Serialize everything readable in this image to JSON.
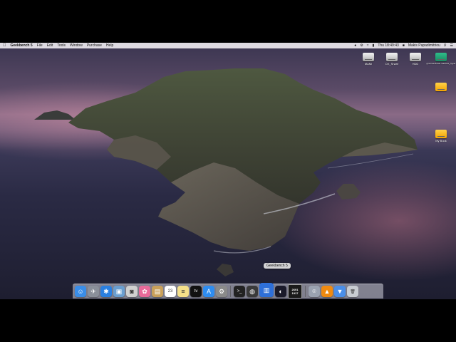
{
  "menubar": {
    "apple": "",
    "app_name": "Geekbench 5",
    "items": [
      "File",
      "Edit",
      "Tools",
      "Window",
      "Purchase",
      "Help"
    ],
    "clock": "Thu 18:49:43",
    "user": "Makis Papadimitriou"
  },
  "desktop_icons": [
    {
      "label": "MAMI",
      "type": "drive"
    },
    {
      "label": "OX_Share",
      "type": "drive"
    },
    {
      "label": "HDD",
      "type": "drive"
    },
    {
      "label": "gnomes18 fast machine_hyper",
      "type": "green"
    },
    {
      "label": "",
      "type": "yellow"
    },
    {
      "label": "My Book",
      "type": "yellow"
    }
  ],
  "dock": {
    "tooltip": "Geekbench 5",
    "badge_top": "2691",
    "badge_bottom": "1917",
    "items": [
      {
        "name": "finder-icon",
        "color": "#3a8de8"
      },
      {
        "name": "launchpad-icon",
        "color": "#8a8f9a"
      },
      {
        "name": "safari-icon",
        "color": "#2a7fe0"
      },
      {
        "name": "preview-icon",
        "color": "#6a9ed0"
      },
      {
        "name": "photos-preview-icon",
        "color": "#d0d0d0"
      },
      {
        "name": "photos-icon",
        "color": "#e86a9a"
      },
      {
        "name": "notes-folder-icon",
        "color": "#c9a05a"
      },
      {
        "name": "calendar-icon",
        "color": "#ffffff"
      },
      {
        "name": "notes-icon",
        "color": "#f5e08a"
      },
      {
        "name": "apple-tv-icon",
        "color": "#111111"
      },
      {
        "name": "app-store-icon",
        "color": "#2e8cf0"
      },
      {
        "name": "system-preferences-icon",
        "color": "#8a8a8a"
      },
      {
        "name": "terminal-icon",
        "color": "#222222"
      },
      {
        "name": "disk-utility-icon",
        "color": "#3a3a3a"
      },
      {
        "name": "geekbench-icon",
        "color": "#2e6fd8"
      },
      {
        "name": "cinebench-icon",
        "color": "#1a1a2a"
      },
      {
        "name": "geekbench-results-icon",
        "color": "#1a1a1a"
      },
      {
        "name": "image-capture-icon",
        "color": "#9aa2b0"
      },
      {
        "name": "vlc-icon",
        "color": "#f08a10"
      },
      {
        "name": "downloads-folder-icon",
        "color": "#4a8ee8"
      },
      {
        "name": "trash-icon",
        "color": "#c8ccd2"
      }
    ]
  }
}
